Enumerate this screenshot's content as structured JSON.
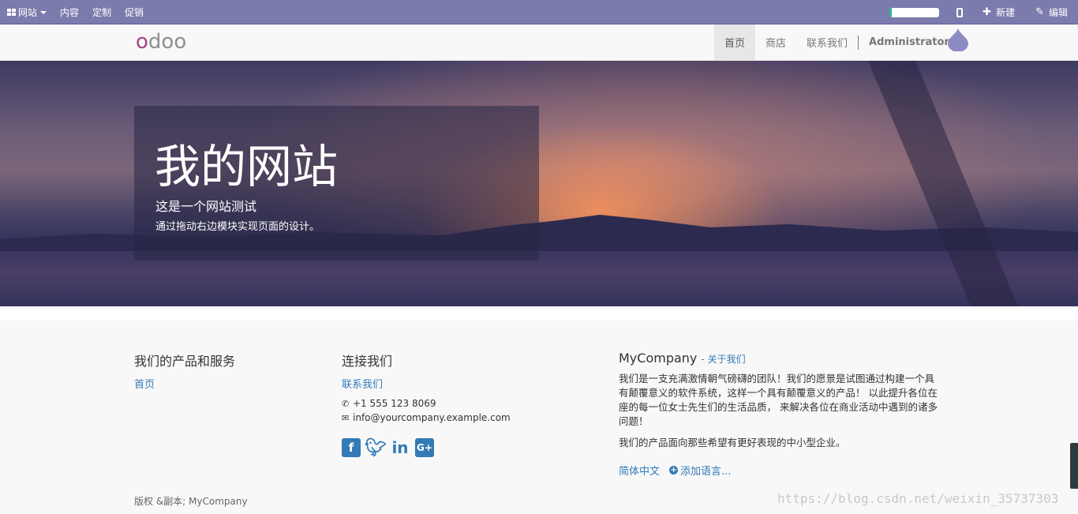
{
  "admin_bar": {
    "website_menu": "网站",
    "items": [
      "内容",
      "定制",
      "促销"
    ],
    "progress_fraction": 0.05,
    "new_label": "新建",
    "edit_label": "编辑",
    "colors": {
      "bar": "#7c7bad",
      "progress": "#21b799"
    }
  },
  "header": {
    "logo_first": "o",
    "logo_rest": "doo",
    "nav": [
      "首页",
      "商店",
      "联系我们"
    ],
    "user": "Administrator"
  },
  "banner": {
    "title": "我的网站",
    "subtitle": "这是一个网站测试",
    "description": "通过拖动右边模块实现页面的设计。"
  },
  "footer": {
    "products": {
      "heading": "我们的产品和服务",
      "link": "首页"
    },
    "connect": {
      "heading": "连接我们",
      "link": "联系我们",
      "phone": "+1 555 123 8069",
      "email": "info@yourcompany.example.com",
      "socials": [
        "facebook-icon",
        "twitter-icon",
        "linkedin-icon",
        "google-plus-icon"
      ]
    },
    "company": {
      "name": "MyCompany",
      "about_link": "- 关于我们",
      "para1": "我们是一支充满激情朝气磅礴的团队！我们的愿景是试图通过构建一个具有颠覆意义的软件系统，这样一个具有颠覆意义的产品！ 以此提升各位在座的每一位女士先生们的生活品质， 来解决各位在商业活动中遇到的诸多问题！",
      "para2": "我们的产品面向那些希望有更好表现的中小型企业。",
      "lang_current": "简体中文",
      "lang_add": "添加语言..."
    },
    "copyright": "版权 &副本; MyCompany",
    "watermark": "https://blog.csdn.net/weixin_35737303"
  }
}
